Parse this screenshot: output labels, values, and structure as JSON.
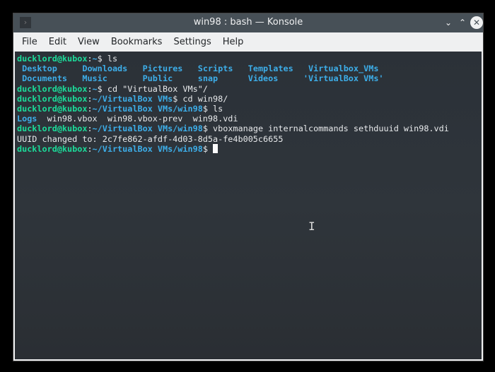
{
  "window": {
    "title": "win98 : bash — Konsole"
  },
  "menu": [
    "File",
    "Edit",
    "View",
    "Bookmarks",
    "Settings",
    "Help"
  ],
  "prompt": {
    "user": "ducklord@kubox",
    "sep": ":",
    "home": "~",
    "vbox": "~/VirtualBox VMs",
    "win98": "~/VirtualBox VMs/win98",
    "dollar": "$"
  },
  "lines": {
    "cmd1": " ls",
    "ls1": [
      " Desktop     ",
      "Downloads   ",
      "Pictures   ",
      "Scripts   ",
      "Templates   ",
      "Virtualbox_VMs"
    ],
    "ls2": [
      " Documents   ",
      "Music       ",
      "Public     ",
      "snap      ",
      "Videos     ",
      "'VirtualBox VMs'"
    ],
    "cmd2": " cd \"VirtualBox VMs\"/",
    "cmd3": " cd win98/",
    "cmd4": " ls",
    "ls3_dir": "Logs",
    "ls3_files": "  win98.vbox  win98.vbox-prev  win98.vdi",
    "cmd5": " vboxmanage internalcommands sethduuid win98.vdi",
    "out": "UUID changed to: 2c7fe862-afdf-4d03-8d5a-fe4b005c6655"
  }
}
